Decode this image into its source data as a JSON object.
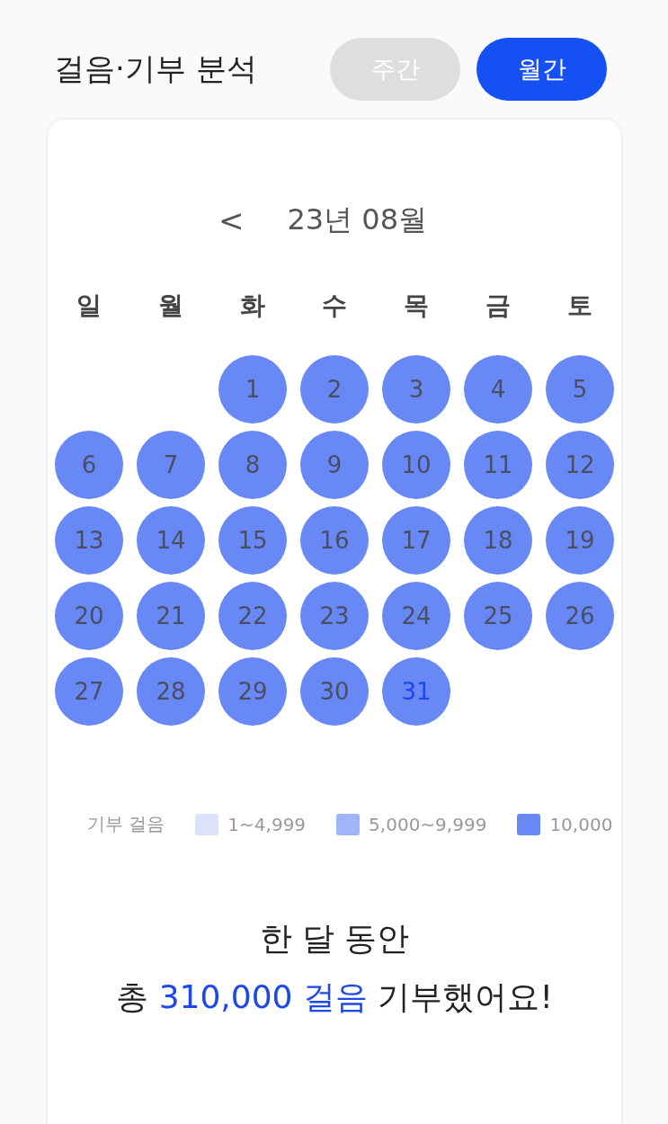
{
  "header": {
    "title": "걸음·기부 분석"
  },
  "tabs": [
    {
      "label": "주간",
      "selected": false
    },
    {
      "label": "월간",
      "selected": true
    }
  ],
  "calendar": {
    "prev": "<",
    "month": "23년 08월",
    "weekdays": [
      "일",
      "월",
      "화",
      "수",
      "목",
      "금",
      "토"
    ],
    "days": [
      {
        "label": "1",
        "color": "#6889f5",
        "today": false
      },
      {
        "label": "2",
        "color": "#6889f5",
        "today": false
      },
      {
        "label": "3",
        "color": "#6889f5",
        "today": false
      },
      {
        "label": "4",
        "color": "#6889f5",
        "today": false
      },
      {
        "label": "5",
        "color": "#6889f5",
        "today": false
      },
      {
        "label": "6",
        "color": "#6889f5",
        "today": false
      },
      {
        "label": "7",
        "color": "#6889f5",
        "today": false
      },
      {
        "label": "8",
        "color": "#6889f5",
        "today": false
      },
      {
        "label": "9",
        "color": "#6889f5",
        "today": false
      },
      {
        "label": "10",
        "color": "#6889f5",
        "today": false
      },
      {
        "label": "11",
        "color": "#6889f5",
        "today": false
      },
      {
        "label": "12",
        "color": "#6889f5",
        "today": false
      },
      {
        "label": "13",
        "color": "#6889f5",
        "today": false
      },
      {
        "label": "14",
        "color": "#6889f5",
        "today": false
      },
      {
        "label": "15",
        "color": "#6889f5",
        "today": false
      },
      {
        "label": "16",
        "color": "#6889f5",
        "today": false
      },
      {
        "label": "17",
        "color": "#6889f5",
        "today": false
      },
      {
        "label": "18",
        "color": "#6889f5",
        "today": false
      },
      {
        "label": "19",
        "color": "#6889f5",
        "today": false
      },
      {
        "label": "20",
        "color": "#6889f5",
        "today": false
      },
      {
        "label": "21",
        "color": "#6889f5",
        "today": false
      },
      {
        "label": "22",
        "color": "#6889f5",
        "today": false
      },
      {
        "label": "23",
        "color": "#6889f5",
        "today": false
      },
      {
        "label": "24",
        "color": "#6889f5",
        "today": false
      },
      {
        "label": "25",
        "color": "#6889f5",
        "today": false
      },
      {
        "label": "26",
        "color": "#6889f5",
        "today": false
      },
      {
        "label": "27",
        "color": "#6889f5",
        "today": false
      },
      {
        "label": "28",
        "color": "#6889f5",
        "today": false
      },
      {
        "label": "29",
        "color": "#6889f5",
        "today": false
      },
      {
        "label": "30",
        "color": "#6889f5",
        "today": false
      },
      {
        "label": "31",
        "color": "#6889f5",
        "today": true
      }
    ]
  },
  "legend": {
    "title": "기부 걸음",
    "items": [
      {
        "label": "1~4,999",
        "color": "#dbe3fc"
      },
      {
        "label": "5,000~9,999",
        "color": "#a0b5f9"
      },
      {
        "label": "10,000",
        "color": "#6889f5"
      }
    ]
  },
  "summary": {
    "line1": "한 달 동안",
    "prefix": "총",
    "amount": "310,000 걸음",
    "suffix": "기부했어요!"
  }
}
